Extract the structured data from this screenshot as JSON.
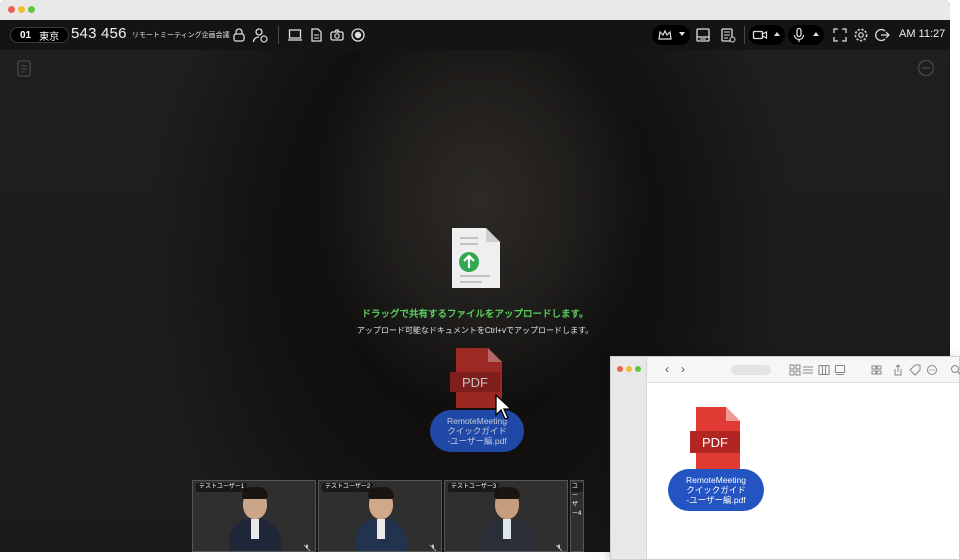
{
  "window": {
    "room_number": "01",
    "room_location": "東京",
    "meeting_id": "543 456",
    "meeting_name": "リモートミーティング企画会議",
    "time": "AM 11:27"
  },
  "toolbar_icons": {
    "left": [
      "lock-icon",
      "user-manage-icon",
      "screen-share-icon",
      "document-icon",
      "camera-icon",
      "record-icon"
    ],
    "right": [
      "crown-icon",
      "layout-icon",
      "document-share-icon",
      "video-icon",
      "microphone-icon",
      "fullscreen-icon",
      "settings-icon",
      "exit-icon"
    ]
  },
  "drop_zone": {
    "title": "ドラッグで共有するファイルをアップロードします。",
    "subtitle": "アップロード可能なドキュメントをCtrl+vでアップロードします。",
    "icon": "upload-document-icon"
  },
  "dragged_file": {
    "type_label": "PDF",
    "name_line1": "RemoteMeeting",
    "name_line2": "クイックガイド",
    "name_line3": "-ユーザー編.pdf"
  },
  "participants": [
    {
      "name": "テストユーザー1"
    },
    {
      "name": "テストユーザー2"
    },
    {
      "name": "テストユーザー3"
    },
    {
      "name": "ユーザー4"
    }
  ],
  "finder": {
    "file_type_label": "PDF",
    "file_name_line1": "RemoteMeeting",
    "file_name_line2": "クイックガイド",
    "file_name_line3": "-ユーザー編.pdf"
  },
  "colors": {
    "accent_green": "#57d15e",
    "pdf_red": "#d9312b",
    "file_label_blue": "#2354c2"
  }
}
